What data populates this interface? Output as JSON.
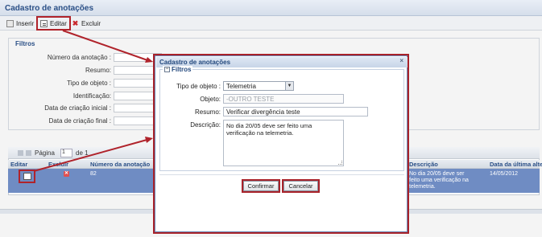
{
  "app": {
    "title": "Cadastro de anotações"
  },
  "toolbar": {
    "insert_label": "Inserir",
    "edit_label": "Editar",
    "delete_label": "Excluir"
  },
  "filters": {
    "legend": "Filtros",
    "labels": {
      "numero": "Número da anotação :",
      "resumo": "Resumo:",
      "tipo": "Tipo de objeto :",
      "identificacao": "Identificação:",
      "data_inicial": "Data de criação inicial :",
      "data_final": "Data de criação final :"
    }
  },
  "pager": {
    "page_label": "Página",
    "page_value": "1",
    "of_label": "de 1"
  },
  "grid": {
    "columns": {
      "editar": "Editar",
      "excluir": "Excluir",
      "numero": "Número da anotação",
      "descricao": "Descrição",
      "data_alteracao": "Data da última alteração"
    },
    "row": {
      "numero": "82",
      "descricao": "No dia 20/05 deve ser feito uma verificação na telemetria.",
      "data_alteracao": "14/05/2012"
    }
  },
  "modal": {
    "title": "Cadastro de anotações",
    "close_glyph": "×",
    "legend": "Filtros",
    "collapse_glyph": "−",
    "labels": {
      "tipo": "Tipo de objeto :",
      "objeto": "Objeto:",
      "resumo": "Resumo:",
      "descricao": "Descrição:"
    },
    "values": {
      "tipo": "Telemetria",
      "objeto": "-OUTRO TESTE",
      "resumo": "Verificar divergência teste",
      "descricao": "No dia 20/05 deve ser feito uma verificação na telemetria."
    },
    "confirm_label": "Confirmar",
    "cancel_label": "Cancelar"
  },
  "colors": {
    "highlight": "#a8222a",
    "accent": "#2a4f86",
    "selected_row": "#6f8cc3"
  },
  "icons": [
    "insert-icon",
    "edit-icon",
    "delete-icon",
    "close-icon",
    "collapse-icon",
    "dropdown-caret-icon"
  ]
}
